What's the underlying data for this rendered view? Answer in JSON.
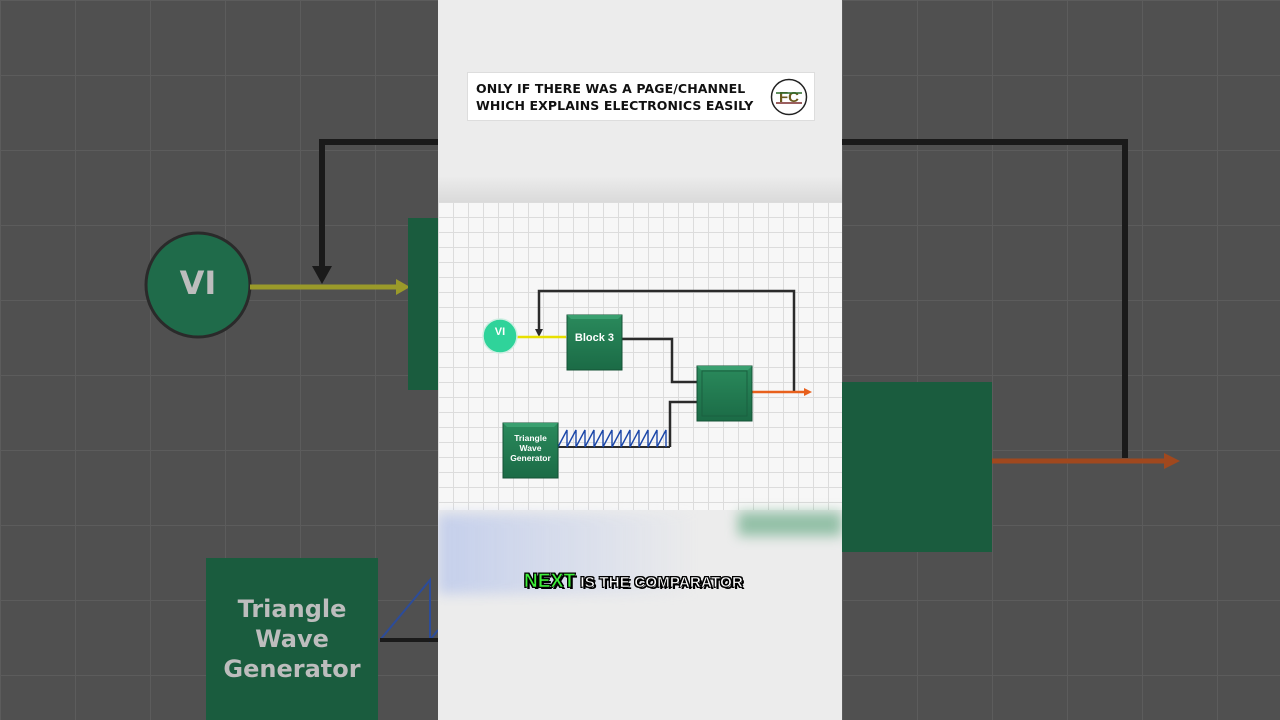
{
  "banner": {
    "line1": "ONLY IF THERE WAS A PAGE/CHANNEL",
    "line2": "WHICH EXPLAINS ELECTRONICS EASILY",
    "logo_text": "FC"
  },
  "diagram": {
    "input_label": "VI",
    "block3_label": "Block 3",
    "generator_label": [
      "Triangle",
      "Wave",
      "Generator"
    ],
    "comparator_label": ""
  },
  "background": {
    "input_label": "VI",
    "generator_label": [
      "Triangle",
      "Wave",
      "Generator"
    ]
  },
  "caption": {
    "highlight": "NEXT",
    "rest": "IS THE COMPARATOR"
  },
  "colors": {
    "block_green": "#1f7a4f",
    "input_circle": "#2fd39a",
    "input_wire": "#e8e000",
    "output_wire": "#e8601c",
    "wave": "#1a46a8",
    "caption_highlight": "#3ef03a"
  }
}
